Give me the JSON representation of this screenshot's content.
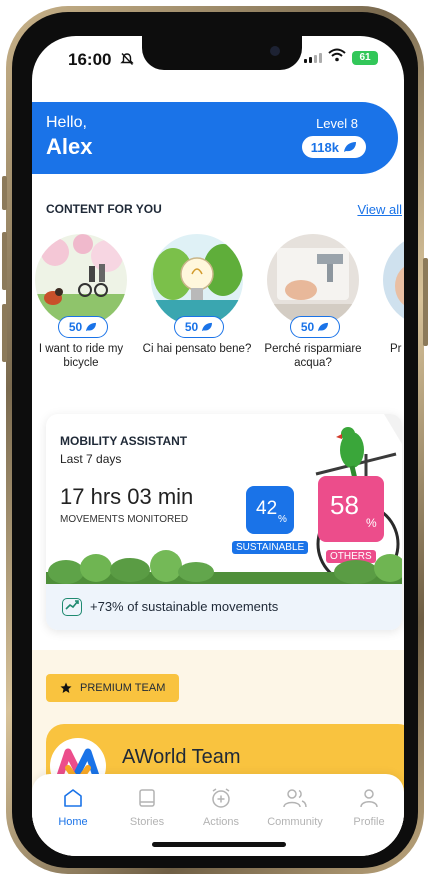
{
  "status_bar": {
    "time": "16:00",
    "battery": "61"
  },
  "greeting": {
    "hello": "Hello,",
    "name": "Alex",
    "level": "Level 8",
    "points": "118k"
  },
  "content_section": {
    "title": "CONTENT FOR YOU",
    "view_all": "View all"
  },
  "content_cards": [
    {
      "points": "50",
      "title": "I want to ride my bicycle"
    },
    {
      "points": "50",
      "title": "Ci hai pensato bene?"
    },
    {
      "points": "50",
      "title": "Perché risparmiare acqua?"
    },
    {
      "points": "",
      "title": "Pr cons"
    }
  ],
  "mobility": {
    "title": "MOBILITY ASSISTANT",
    "period": "Last 7 days",
    "hours": "17 hrs 03 min",
    "monitored": "MOVEMENTS MONITORED",
    "sustainable_value": "42",
    "sustainable_label": "SUSTAINABLE",
    "others_value": "58",
    "others_label": "OTHERS",
    "percent_sign": "%",
    "trend_text": "+73% of sustainable movements"
  },
  "team": {
    "badge": "PREMIUM TEAM",
    "name": "AWorld Team"
  },
  "tabs": [
    {
      "label": "Home",
      "icon": "home-icon",
      "active": true
    },
    {
      "label": "Stories",
      "icon": "book-icon",
      "active": false
    },
    {
      "label": "Actions",
      "icon": "alarm-plus-icon",
      "active": false
    },
    {
      "label": "Community",
      "icon": "users-icon",
      "active": false
    },
    {
      "label": "Profile",
      "icon": "user-icon",
      "active": false
    }
  ],
  "colors": {
    "brand_blue": "#1a73e8",
    "pink": "#ec4d8b",
    "yellow": "#f9c33f",
    "cream": "#fdf6e7"
  }
}
